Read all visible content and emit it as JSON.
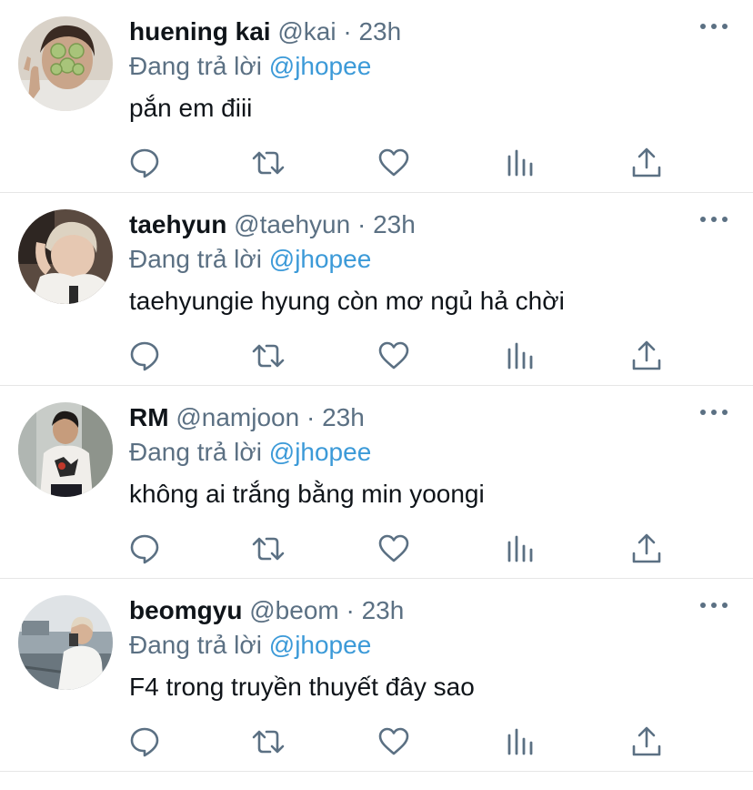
{
  "reply_prefix": "Đang trả lời",
  "reply_target": "@jhopee",
  "colors": {
    "text": "#0f1419",
    "muted": "#5b7083",
    "link": "#3c9ad8",
    "divider": "#e6e6e6"
  },
  "icons": {
    "reply": "reply-icon",
    "retweet": "retweet-icon",
    "like": "heart-icon",
    "stats": "bar-chart-icon",
    "share": "share-icon",
    "more": "more-icon"
  },
  "tweets": [
    {
      "display_name": "huening kai",
      "handle": "@kai",
      "separator": "·",
      "time": "23h",
      "text": "pắn em điii"
    },
    {
      "display_name": "taehyun",
      "handle": "@taehyun",
      "separator": "·",
      "time": "23h",
      "text": "taehyungie hyung còn mơ ngủ hả chời"
    },
    {
      "display_name": "RM",
      "handle": "@namjoon",
      "separator": "·",
      "time": "23h",
      "text": "không ai trắng bằng min yoongi"
    },
    {
      "display_name": "beomgyu",
      "handle": "@beom",
      "separator": "·",
      "time": "23h",
      "text": "F4 trong truyền thuyết đây sao"
    }
  ]
}
